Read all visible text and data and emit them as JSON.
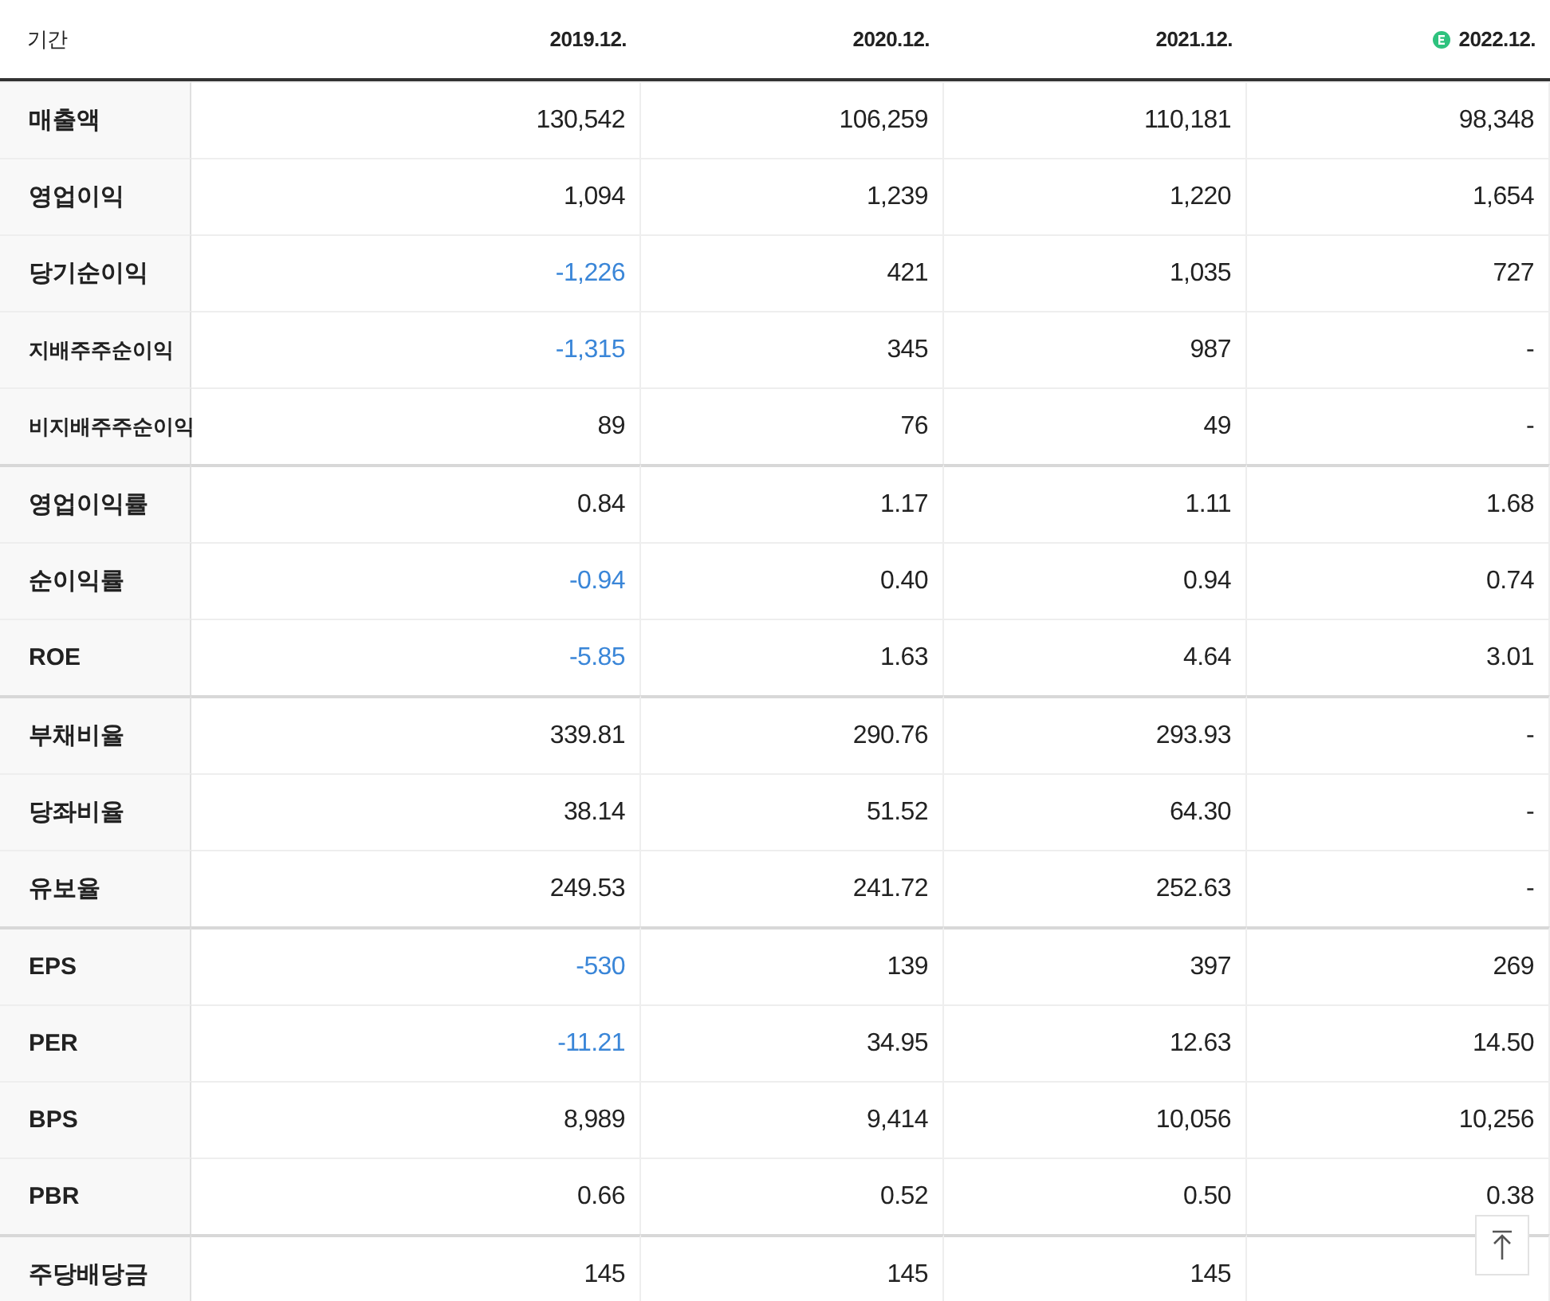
{
  "table": {
    "header_label": "기간",
    "columns": [
      {
        "label": "2019.12.",
        "estimate": false
      },
      {
        "label": "2020.12.",
        "estimate": false
      },
      {
        "label": "2021.12.",
        "estimate": false
      },
      {
        "label": "2022.12.",
        "estimate": true
      }
    ],
    "rows": [
      {
        "label": "매출액",
        "kind": "main",
        "group_start": false,
        "cells": [
          {
            "text": "130,542",
            "negative": false
          },
          {
            "text": "106,259",
            "negative": false
          },
          {
            "text": "110,181",
            "negative": false
          },
          {
            "text": "98,348",
            "negative": false
          }
        ]
      },
      {
        "label": "영업이익",
        "kind": "main",
        "group_start": false,
        "cells": [
          {
            "text": "1,094",
            "negative": false
          },
          {
            "text": "1,239",
            "negative": false
          },
          {
            "text": "1,220",
            "negative": false
          },
          {
            "text": "1,654",
            "negative": false
          }
        ]
      },
      {
        "label": "당기순이익",
        "kind": "main",
        "group_start": false,
        "cells": [
          {
            "text": "-1,226",
            "negative": true
          },
          {
            "text": "421",
            "negative": false
          },
          {
            "text": "1,035",
            "negative": false
          },
          {
            "text": "727",
            "negative": false
          }
        ]
      },
      {
        "label": "지배주주순이익",
        "kind": "sub",
        "group_start": false,
        "cells": [
          {
            "text": "-1,315",
            "negative": true
          },
          {
            "text": "345",
            "negative": false
          },
          {
            "text": "987",
            "negative": false
          },
          {
            "text": "-",
            "negative": false
          }
        ]
      },
      {
        "label": "비지배주주순이익",
        "kind": "sub",
        "group_start": false,
        "cells": [
          {
            "text": "89",
            "negative": false
          },
          {
            "text": "76",
            "negative": false
          },
          {
            "text": "49",
            "negative": false
          },
          {
            "text": "-",
            "negative": false
          }
        ]
      },
      {
        "label": "영업이익률",
        "kind": "main",
        "group_start": true,
        "cells": [
          {
            "text": "0.84",
            "negative": false
          },
          {
            "text": "1.17",
            "negative": false
          },
          {
            "text": "1.11",
            "negative": false
          },
          {
            "text": "1.68",
            "negative": false
          }
        ]
      },
      {
        "label": "순이익률",
        "kind": "main",
        "group_start": false,
        "cells": [
          {
            "text": "-0.94",
            "negative": true
          },
          {
            "text": "0.40",
            "negative": false
          },
          {
            "text": "0.94",
            "negative": false
          },
          {
            "text": "0.74",
            "negative": false
          }
        ]
      },
      {
        "label": "ROE",
        "kind": "main",
        "group_start": false,
        "cells": [
          {
            "text": "-5.85",
            "negative": true
          },
          {
            "text": "1.63",
            "negative": false
          },
          {
            "text": "4.64",
            "negative": false
          },
          {
            "text": "3.01",
            "negative": false
          }
        ]
      },
      {
        "label": "부채비율",
        "kind": "main",
        "group_start": true,
        "cells": [
          {
            "text": "339.81",
            "negative": false
          },
          {
            "text": "290.76",
            "negative": false
          },
          {
            "text": "293.93",
            "negative": false
          },
          {
            "text": "-",
            "negative": false
          }
        ]
      },
      {
        "label": "당좌비율",
        "kind": "main",
        "group_start": false,
        "cells": [
          {
            "text": "38.14",
            "negative": false
          },
          {
            "text": "51.52",
            "negative": false
          },
          {
            "text": "64.30",
            "negative": false
          },
          {
            "text": "-",
            "negative": false
          }
        ]
      },
      {
        "label": "유보율",
        "kind": "main",
        "group_start": false,
        "cells": [
          {
            "text": "249.53",
            "negative": false
          },
          {
            "text": "241.72",
            "negative": false
          },
          {
            "text": "252.63",
            "negative": false
          },
          {
            "text": "-",
            "negative": false
          }
        ]
      },
      {
        "label": "EPS",
        "kind": "main",
        "group_start": true,
        "cells": [
          {
            "text": "-530",
            "negative": true
          },
          {
            "text": "139",
            "negative": false
          },
          {
            "text": "397",
            "negative": false
          },
          {
            "text": "269",
            "negative": false
          }
        ]
      },
      {
        "label": "PER",
        "kind": "main",
        "group_start": false,
        "cells": [
          {
            "text": "-11.21",
            "negative": true
          },
          {
            "text": "34.95",
            "negative": false
          },
          {
            "text": "12.63",
            "negative": false
          },
          {
            "text": "14.50",
            "negative": false
          }
        ]
      },
      {
        "label": "BPS",
        "kind": "main",
        "group_start": false,
        "cells": [
          {
            "text": "8,989",
            "negative": false
          },
          {
            "text": "9,414",
            "negative": false
          },
          {
            "text": "10,056",
            "negative": false
          },
          {
            "text": "10,256",
            "negative": false
          }
        ]
      },
      {
        "label": "PBR",
        "kind": "main",
        "group_start": false,
        "cells": [
          {
            "text": "0.66",
            "negative": false
          },
          {
            "text": "0.52",
            "negative": false
          },
          {
            "text": "0.50",
            "negative": false
          },
          {
            "text": "0.38",
            "negative": false
          }
        ]
      },
      {
        "label": "주당배당금",
        "kind": "main",
        "group_start": true,
        "cells": [
          {
            "text": "145",
            "negative": false
          },
          {
            "text": "145",
            "negative": false
          },
          {
            "text": "145",
            "negative": false
          }
        ]
      }
    ]
  },
  "scroll_top_button": {
    "visible": true
  }
}
